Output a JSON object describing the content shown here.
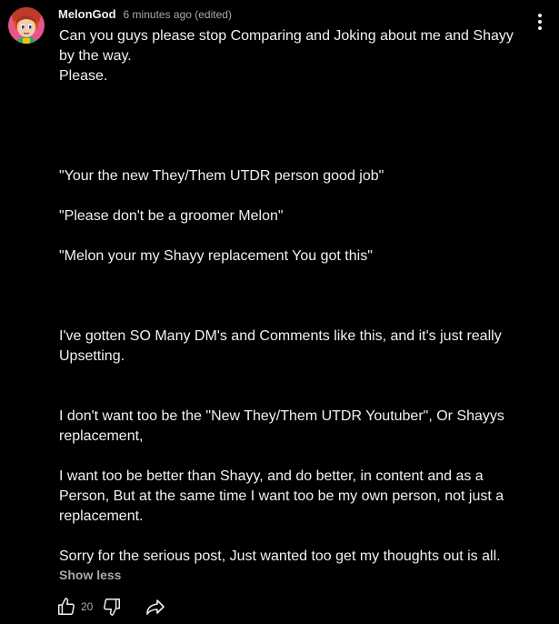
{
  "comment": {
    "author": "MelonGod",
    "timestamp": "6 minutes ago (edited)",
    "lines": [
      "Can you guys please stop Comparing and Joking about me and Shayy",
      "by the way.",
      "Please.",
      "",
      "",
      "",
      "",
      "\"Your the new They/Them UTDR person good job\"",
      "",
      "\"Please don't be a groomer Melon\"",
      "",
      "\"Melon your my Shayy replacement You got this\"",
      "",
      "",
      "",
      "I've gotten SO Many DM's and Comments like this, and it's just really",
      "Upsetting.",
      "",
      "",
      "I don't want too be the \"New They/Them UTDR Youtuber\", Or Shayys",
      "replacement,",
      "",
      "I want too be better than Shayy, and do better, in content and as a",
      "Person, But at the same time I want too be my own person, not just a",
      "replacement.",
      "",
      "Sorry for the serious post, Just wanted too get my thoughts out is all."
    ],
    "show_less_label": "Show less",
    "like_count": "20"
  },
  "icons": {
    "avatar": "avatar-image",
    "menu": "more-vertical-icon",
    "like": "thumbs-up-icon",
    "dislike": "thumbs-down-icon",
    "share": "share-icon"
  },
  "colors": {
    "background": "#000000",
    "text_primary": "#f1f1f1",
    "text_secondary": "#aaaaaa",
    "avatar_bg": "#e8548c"
  }
}
